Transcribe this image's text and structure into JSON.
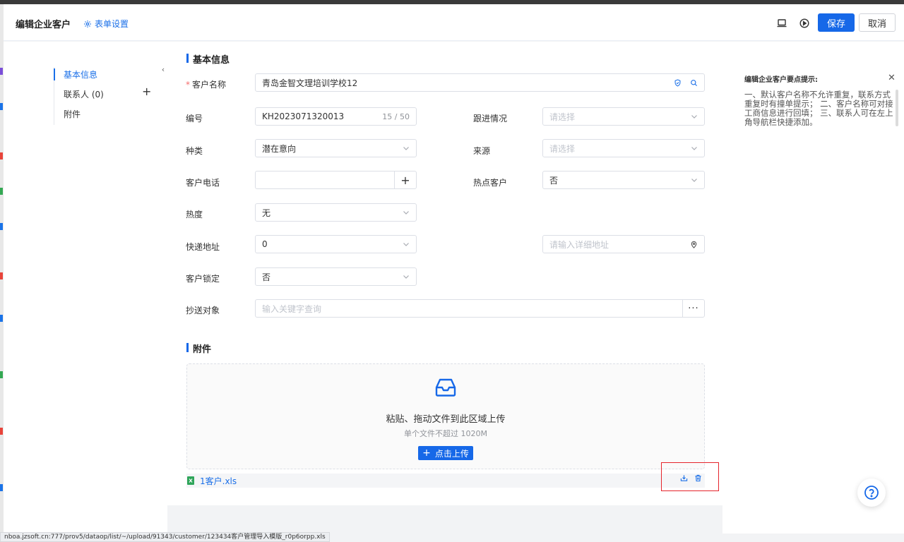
{
  "header": {
    "title": "编辑企业客户",
    "form_settings": "表单设置",
    "save": "保存",
    "cancel": "取消"
  },
  "nav": {
    "items": [
      {
        "label": "基本信息",
        "active": true
      },
      {
        "label": "联系人  (0)"
      },
      {
        "label": "附件"
      }
    ]
  },
  "basic": {
    "section_title": "基本信息",
    "customer_name": {
      "label": "客户名称",
      "value": "青岛金智文理培训学校12"
    },
    "code": {
      "label": "编号",
      "value": "KH2023071320013",
      "count": "15 / 50"
    },
    "followup": {
      "label": "跟进情况",
      "placeholder": "请选择"
    },
    "category": {
      "label": "种类",
      "value": "潜在意向"
    },
    "source": {
      "label": "来源",
      "placeholder": "请选择"
    },
    "phone": {
      "label": "客户电话",
      "value": ""
    },
    "hot_customer": {
      "label": "热点客户",
      "value": "否"
    },
    "heat": {
      "label": "热度",
      "value": "无"
    },
    "express": {
      "label": "快递地址",
      "value": "0",
      "detail_placeholder": "请输入详细地址"
    },
    "lock": {
      "label": "客户锁定",
      "value": "否"
    },
    "cc": {
      "label": "抄送对象",
      "placeholder": "输入关键字查询"
    }
  },
  "attachments": {
    "section_title": "附件",
    "upload_text": "粘贴、拖动文件到此区域上传",
    "upload_limit": "单个文件不超过 1020M",
    "upload_button": "点击上传",
    "file_name": "1客户.xls"
  },
  "tips": {
    "title": "编辑企业客户要点提示:",
    "body": "一、默认客户名称不允许重复，联系方式重复时有撞单提示；  二、客户名称可对接工商信息进行回填；  三、联系人可在左上角导航栏快捷添加。"
  },
  "status_url": "nboa.jzsoft.cn:777/prov5/dataop/list/~/upload/91343/customer/123434客户管理导入模版_r0p6orpp.xls",
  "colors": {
    "primary": "#1668e8",
    "highlight": "#e5242b",
    "required": "#f56c6c"
  }
}
